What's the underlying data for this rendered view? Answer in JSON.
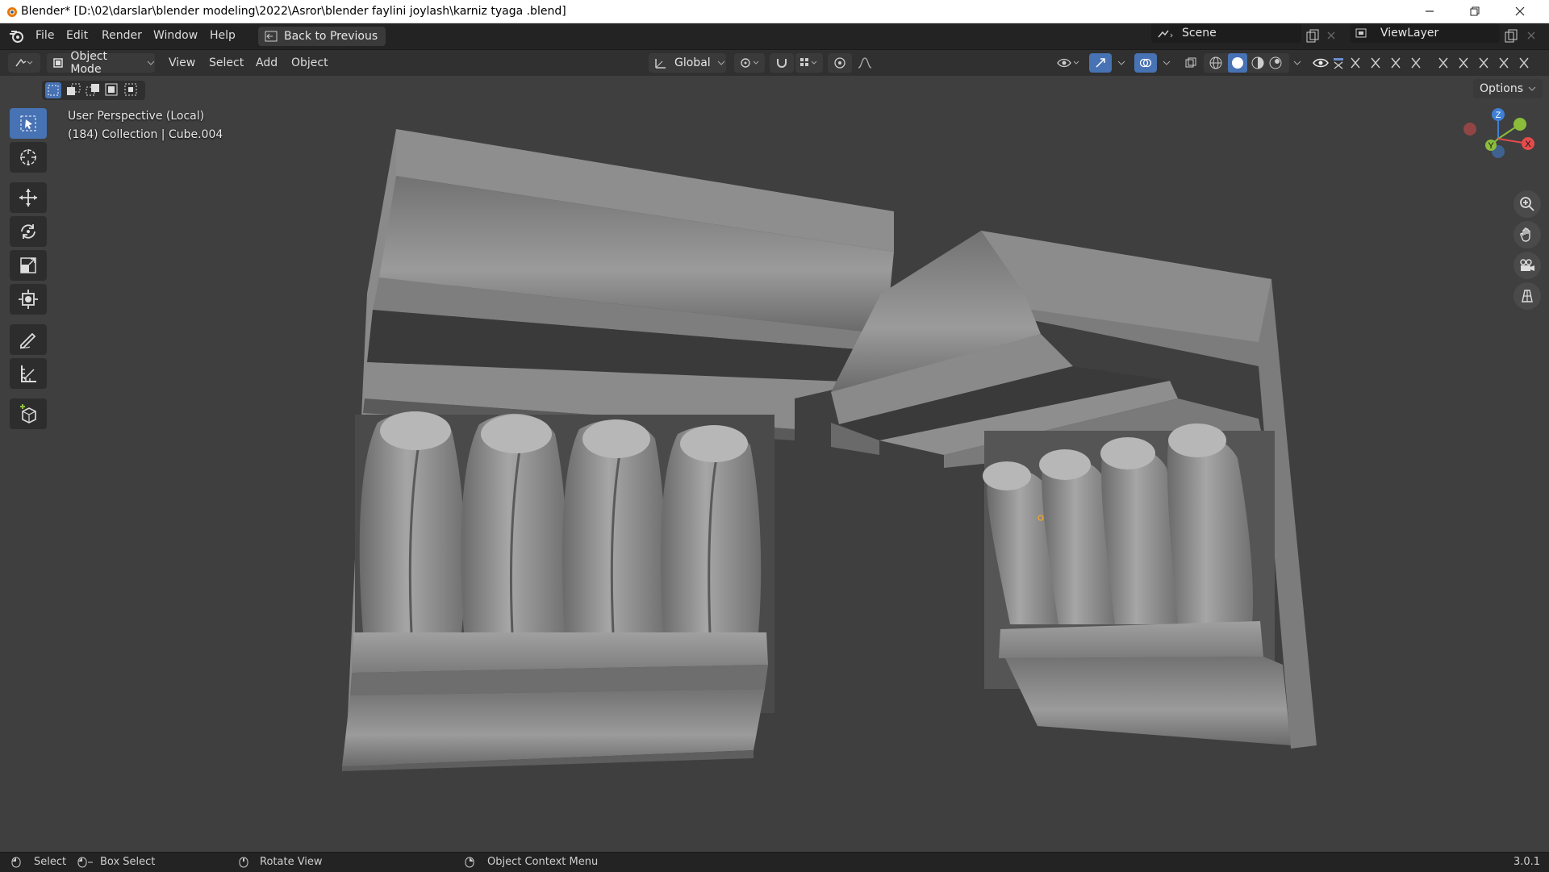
{
  "window": {
    "title": "Blender* [D:\\02\\darslar\\blender modeling\\2022\\Asror\\blender faylini joylash\\karniz tyaga .blend]"
  },
  "menubar": {
    "items": [
      "File",
      "Edit",
      "Render",
      "Window",
      "Help"
    ],
    "back_label": "Back to Previous",
    "scene_label": "Scene",
    "viewlayer_label": "ViewLayer"
  },
  "header3d": {
    "mode_label": "Object Mode",
    "menus": [
      "View",
      "Select",
      "Add",
      "Object"
    ],
    "orientation_label": "Global",
    "options_label": "Options"
  },
  "viewport": {
    "perspective_label": "User Perspective (Local)",
    "collection_label": "(184) Collection | Cube.004",
    "gizmo": {
      "z": "Z",
      "y": "Y",
      "x": "X"
    }
  },
  "statusbar": {
    "select": "Select",
    "box_select": "Box Select",
    "rotate_view": "Rotate View",
    "context_menu": "Object Context Menu",
    "version": "3.0.1"
  },
  "colors": {
    "accent": "#4772b3",
    "viewport_bg": "#3f3f3f",
    "axis_x": "#e44b4b",
    "axis_y": "#8bbd3b",
    "axis_z": "#3f7fd6"
  },
  "icons": [
    "blender-logo-icon",
    "minimize-icon",
    "maximize-icon",
    "close-icon",
    "select-box-icon",
    "cursor-icon",
    "move-icon",
    "rotate-icon",
    "scale-icon",
    "transform-icon",
    "annotate-icon",
    "measure-icon",
    "add-cube-icon",
    "zoom-icon",
    "hand-icon",
    "camera-icon",
    "grid-icon"
  ]
}
